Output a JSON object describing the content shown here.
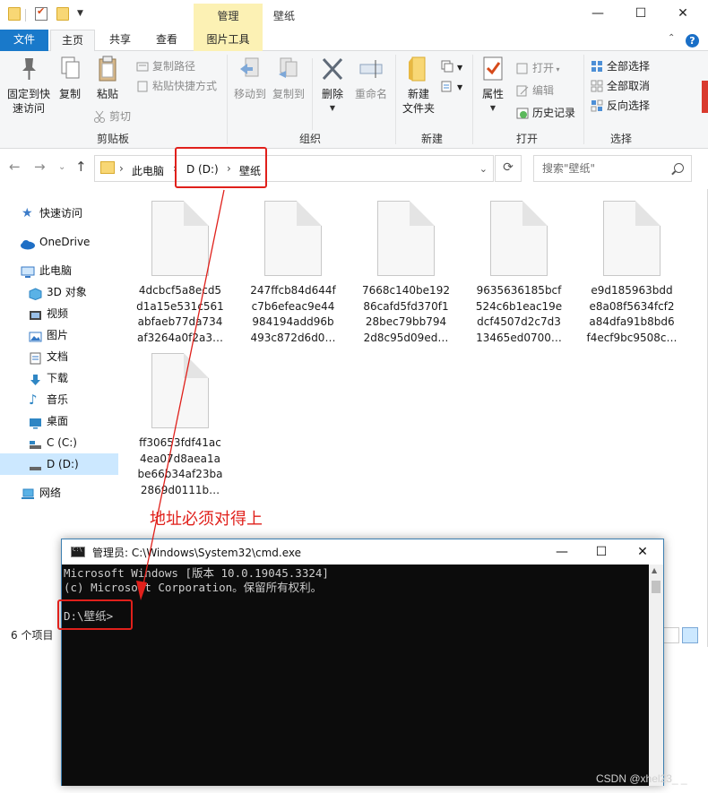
{
  "explorer": {
    "contextual_tab": "管理",
    "window_title": "壁纸",
    "controls": {
      "minimize": "—",
      "maximize": "☐",
      "close": "✕"
    },
    "tabs": [
      "文件",
      "主页",
      "共享",
      "查看",
      "图片工具"
    ],
    "help": "?",
    "ribbon": {
      "clipboard": {
        "pin": "固定到快\n速访问",
        "copy": "复制",
        "paste": "粘贴",
        "copy_path": "复制路径",
        "paste_shortcut": "粘贴快捷方式",
        "cut": "剪切",
        "label": "剪贴板"
      },
      "organize": {
        "move_to": "移动到",
        "copy_to": "复制到",
        "delete": "删除",
        "rename": "重命名",
        "label": "组织"
      },
      "new": {
        "new_folder": "新建\n文件夹",
        "label": "新建"
      },
      "open": {
        "properties": "属性",
        "open": "打开",
        "edit": "编辑",
        "history": "历史记录",
        "label": "打开"
      },
      "select": {
        "select_all": "全部选择",
        "select_none": "全部取消",
        "invert": "反向选择",
        "label": "选择"
      }
    },
    "address": {
      "crumbs": [
        "此电脑",
        "D (D:)",
        "壁纸"
      ],
      "search_placeholder": "搜索\"壁纸\""
    },
    "sidebar": [
      {
        "label": "快速访问",
        "icon": "star-icon"
      },
      {
        "label": "OneDrive",
        "icon": "cloud-icon"
      },
      {
        "label": "此电脑",
        "icon": "computer-icon"
      },
      {
        "label": "3D 对象",
        "icon": "cube-icon"
      },
      {
        "label": "视频",
        "icon": "video-icon"
      },
      {
        "label": "图片",
        "icon": "picture-icon"
      },
      {
        "label": "文档",
        "icon": "document-icon"
      },
      {
        "label": "下载",
        "icon": "download-icon"
      },
      {
        "label": "音乐",
        "icon": "music-icon"
      },
      {
        "label": "桌面",
        "icon": "desktop-icon"
      },
      {
        "label": "C (C:)",
        "icon": "drive-icon"
      },
      {
        "label": "D (D:)",
        "icon": "drive-icon"
      },
      {
        "label": "网络",
        "icon": "network-icon"
      }
    ],
    "files": [
      {
        "name": "4dcbcf5a8ecd5\nd1a15e531c561\nabfaeb77da734\naf3264a0f2a3…"
      },
      {
        "name": "247ffcb84d644f\nc7b6efeac9e44\n984194add96b\n493c872d6d0…"
      },
      {
        "name": "7668c140be192\n86cafd5fd370f1\n28bec79bb794\n2d8c95d09ed…"
      },
      {
        "name": "9635636185bcf\n524c6b1eac19e\ndcf4507d2c7d3\n13465ed0700…"
      },
      {
        "name": "e9d185963bdd\ne8a08f5634fcf2\na84dfa91b8bd6\nf4ecf9bc9508c…"
      },
      {
        "name": "ff30653fdf41ac\n4ea07d8aea1a\nbe66b34af23ba\n2869d0111b…"
      }
    ],
    "status": "6 个项目"
  },
  "cmd": {
    "title": "管理员: C:\\Windows\\System32\\cmd.exe",
    "controls": {
      "minimize": "—",
      "maximize": "☐",
      "close": "✕"
    },
    "lines": [
      "Microsoft Windows [版本 10.0.19045.3324]",
      "(c) Microsoft Corporation。保留所有权利。",
      "",
      "D:\\壁纸>"
    ]
  },
  "annotation": {
    "note": "地址必须对得上",
    "color": "#e0201b"
  },
  "watermark": "CSDN @xhel23_ _"
}
